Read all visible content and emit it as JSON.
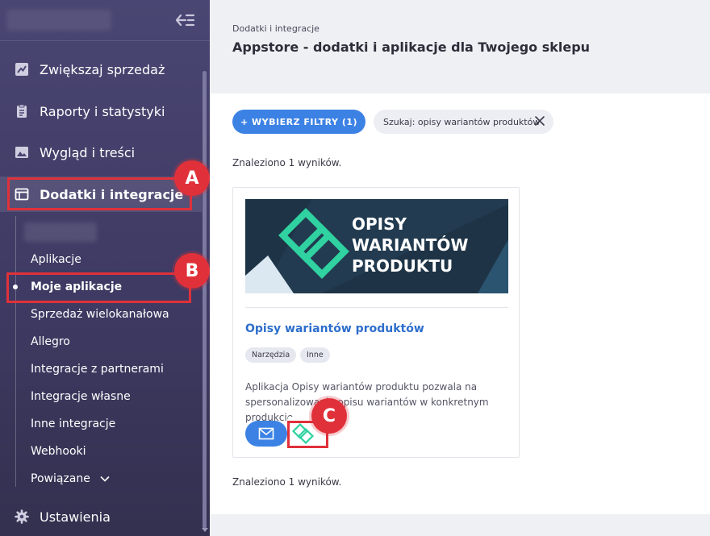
{
  "sidebar": {
    "items": [
      {
        "label": "Zwiększaj sprzedaż",
        "icon": "trending-up-icon"
      },
      {
        "label": "Raporty i statystyki",
        "icon": "clipboard-icon"
      },
      {
        "label": "Wygląd i treści",
        "icon": "image-icon"
      },
      {
        "label": "Dodatki i integracje",
        "icon": "window-icon"
      }
    ],
    "subitems": [
      "Aplikacje",
      "Moje aplikacje",
      "Sprzedaż wielokanałowa",
      "Allegro",
      "Integracje z partnerami",
      "Integracje własne",
      "Inne integracje",
      "Webhooki",
      "Powiązane"
    ],
    "settings": {
      "label": "Ustawienia",
      "icon": "gear-icon"
    }
  },
  "markers": {
    "a": "A",
    "b": "B",
    "c": "C"
  },
  "header": {
    "breadcrumb": "Dodatki i integracje",
    "title": "Appstore - dodatki i aplikacje dla Twojego sklepu"
  },
  "filters": {
    "button_label": "+ WYBIERZ FILTRY (1)",
    "search_chip": "Szukaj: opisy wariantów produktów"
  },
  "results_text": "Znaleziono 1 wyników.",
  "card": {
    "banner_lines": [
      "OPISY",
      "WARIANTÓW",
      "PRODUKTU"
    ],
    "title": "Opisy wariantów produktów",
    "tags": [
      "Narzędzia",
      "Inne"
    ],
    "description": "Aplikacja Opisy wariantów produktu pozwala na spersonalizowanie opisu wariantów w konkretnym produkcie."
  },
  "colors": {
    "sidebar": "#4a4673",
    "accent": "#3c82e4",
    "highlight": "#e0313a",
    "banner": "#1e3446",
    "brand_green": "#2fd2a0"
  }
}
